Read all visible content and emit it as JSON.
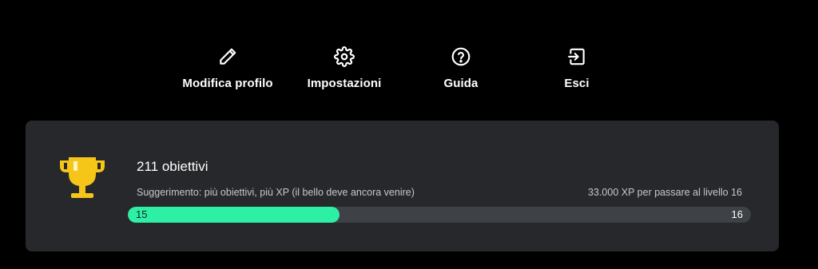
{
  "header": {
    "partial_title": "· · · · ·"
  },
  "actions": [
    {
      "label": "Modifica profilo",
      "icon": "pencil-icon"
    },
    {
      "label": "Impostazioni",
      "icon": "gear-icon"
    },
    {
      "label": "Guida",
      "icon": "help-circle-icon"
    },
    {
      "label": "Esci",
      "icon": "logout-icon"
    }
  ],
  "achievements": {
    "icon": "trophy-icon",
    "title": "211 obiettivi",
    "hint": "Suggerimento: più obiettivi, più XP (il bello deve ancora venire)",
    "xp_to_next": "33.000 XP per passare al livello 16",
    "current_level": "15",
    "next_level": "16",
    "progress_fraction": 0.34
  },
  "colors": {
    "background": "#000000",
    "card": "#27282b",
    "progress_fill": "#2ef0a4",
    "progress_track": "#3e4145",
    "trophy": "#f5c518"
  }
}
